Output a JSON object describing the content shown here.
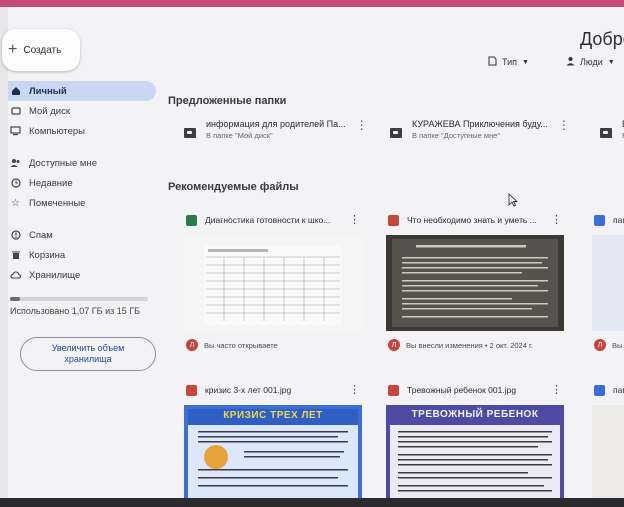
{
  "colors": {
    "accent_top": "#c64a78",
    "sidebar_active": "#c9d7f2",
    "sheet": "#2a7a49",
    "image": "#c9463d",
    "doc": "#3a6fd8"
  },
  "sidebar": {
    "create_label": "Создать",
    "items": [
      {
        "label": "Личный",
        "icon": "home-icon",
        "active": true
      },
      {
        "label": "Мой диск",
        "icon": "drive-icon"
      },
      {
        "label": "Компьютеры",
        "icon": "computer-icon"
      },
      {
        "label": "Доступные мне",
        "icon": "people-icon"
      },
      {
        "label": "Недавние",
        "icon": "clock-icon"
      },
      {
        "label": "Помеченные",
        "icon": "star-icon"
      },
      {
        "label": "Спам",
        "icon": "spam-icon"
      },
      {
        "label": "Корзина",
        "icon": "trash-icon"
      },
      {
        "label": "Хранилище",
        "icon": "cloud-icon"
      }
    ],
    "storage_used_fraction": 0.07,
    "storage_text": "Использовано 1,07 ГБ из 15 ГБ",
    "upgrade_label": "Увеличить объем хранилища"
  },
  "header": {
    "greeting": "Добро",
    "filter_type": "Тип",
    "filter_people": "Люди"
  },
  "suggested_folders": {
    "title": "Предложенные папки",
    "items": [
      {
        "name": "информация для родителей Па...",
        "location": "В папке \"Мой диск\""
      },
      {
        "name": "КУРАЖЕВА Приключения буду...",
        "location": "В папке \"Доступные мне\""
      },
      {
        "name": "Бо",
        "location": "В п"
      }
    ]
  },
  "recommended_files": {
    "title": "Рекомендуемые файлы",
    "items": [
      {
        "name": "Диагностика готовности к шко...",
        "type": "sheet",
        "avatar": "Л",
        "activity": "Вы часто открываете"
      },
      {
        "name": "Что необходимо знать и уметь ...",
        "type": "image",
        "avatar": "Л",
        "activity": "Вы внесли изменения • 2 окт. 2024 г."
      },
      {
        "name": "пам",
        "type": "doc",
        "avatar": "Л",
        "activity": "Вы откр"
      },
      {
        "name": "кризис 3-х лет 001.jpg",
        "type": "image",
        "thumb_heading": "КРИЗИС ТРЕХ ЛЕТ"
      },
      {
        "name": "Тревожный ребенок 001.jpg",
        "type": "image",
        "thumb_heading": "ТРЕВОЖНЫЙ РЕБЕНОК"
      },
      {
        "name": "пам. д",
        "type": "doc"
      }
    ]
  }
}
